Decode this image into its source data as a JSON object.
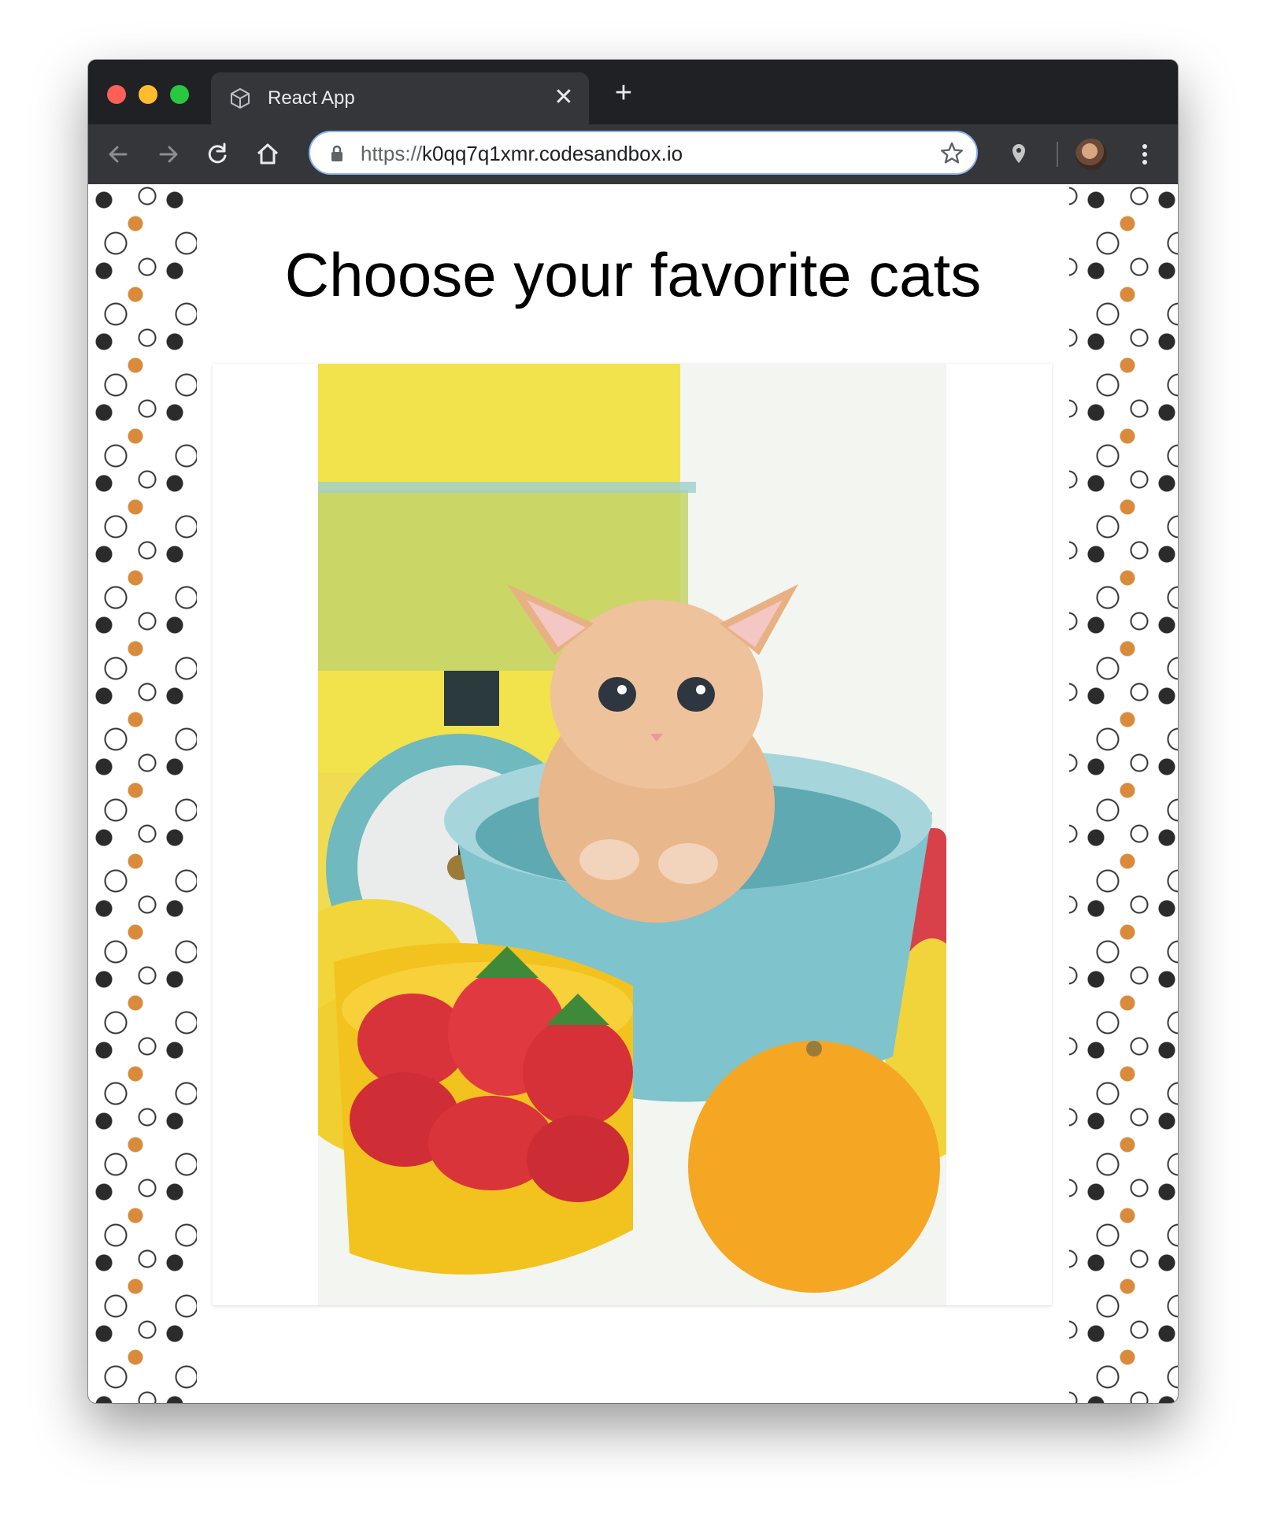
{
  "browser": {
    "tab": {
      "title": "React App",
      "icon": "codesandbox-cube-icon",
      "close_icon": "close-icon"
    },
    "new_tab_icon": "plus-icon",
    "nav": {
      "back": "arrow-left-icon",
      "forward": "arrow-right-icon",
      "reload": "reload-icon",
      "home": "home-icon"
    },
    "address_bar": {
      "scheme": "https://",
      "host": "k0qq7q1xmr.codesandbox.io"
    },
    "extensions": {
      "location": "location-pin-icon",
      "menu": "more-vert-icon"
    }
  },
  "page": {
    "heading": "Choose your favorite cats",
    "image": {
      "subject": "kitten-in-bowl"
    }
  },
  "colors": {
    "chrome_dark": "#202124",
    "chrome_tab": "#35363a",
    "omnibox_border": "#8ab4f8"
  }
}
